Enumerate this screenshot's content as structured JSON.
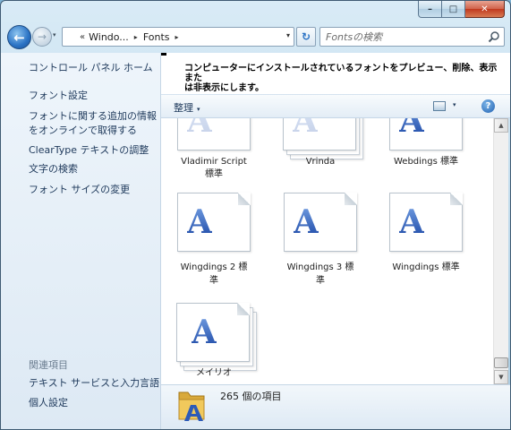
{
  "window": {
    "caption": {
      "minimize": "–",
      "maximize": "□",
      "close": "✕"
    }
  },
  "nav": {
    "back_glyph": "←",
    "forward_glyph": "→",
    "history_glyph": "▾",
    "address": {
      "prefix": "«",
      "segments": [
        "Windo...",
        "Fonts"
      ],
      "sep": "▸",
      "dropdown": "▾"
    },
    "refresh_glyph": "↻",
    "search": {
      "placeholder": "Fontsの検索",
      "value": ""
    }
  },
  "sidebar": {
    "tasks": [
      "コントロール パネル ホーム",
      "フォント設定",
      "フォントに関する追加の情報",
      "をオンラインで取得する",
      "ClearType テキストの調整",
      "文字の検索",
      "フォント サイズの変更"
    ],
    "related_heading": "関連項目",
    "related": [
      "テキスト サービスと入力言語",
      "個人設定"
    ]
  },
  "main": {
    "description_line1": "コンピューターにインストールされているフォントをプレビュー、削除、表示また",
    "description_line2": "は非表示にします。"
  },
  "toolbar": {
    "organize_label": "整理",
    "organize_caret": "▾",
    "view_caret": "▾",
    "help_glyph": "?"
  },
  "fonts": {
    "glyph": "A",
    "items": [
      {
        "line1": "Vladimir Script",
        "line2": "標準"
      },
      {
        "line1": "Vrinda",
        "line2": ""
      },
      {
        "line1": "Webdings 標準",
        "line2": ""
      },
      {
        "line1": "Wingdings 2 標",
        "line2": "準"
      },
      {
        "line1": "Wingdings 3 標",
        "line2": "準"
      },
      {
        "line1": "Wingdings 標準",
        "line2": ""
      },
      {
        "line1": "メイリオ",
        "line2": ""
      }
    ]
  },
  "scrollbar": {
    "up": "▲",
    "down": "▼"
  },
  "details": {
    "count_text": "265 個の項目"
  }
}
